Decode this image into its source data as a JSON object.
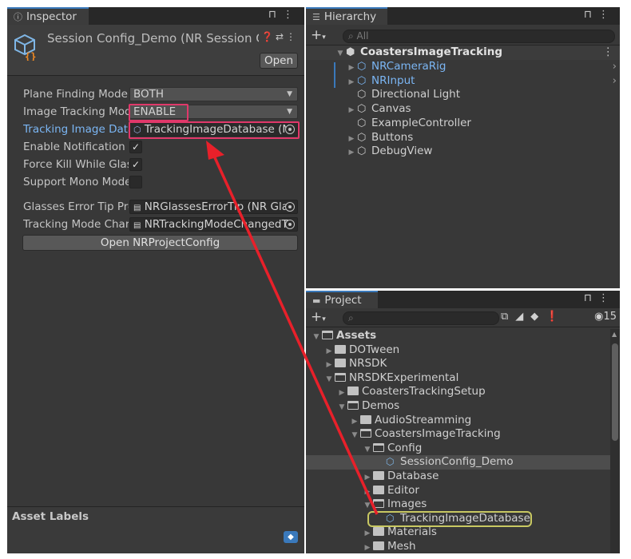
{
  "inspector": {
    "tab_label": "Inspector",
    "title": "Session Config_Demo (NR Session Co",
    "open_button": "Open",
    "fields": [
      {
        "label": "Plane Finding Mode",
        "value": "BOTH",
        "kind": "dropdown"
      },
      {
        "label": "Image Tracking Mod",
        "value": "ENABLE",
        "kind": "dropdown"
      },
      {
        "label": "Tracking Image Data",
        "value": "TrackingImageDatabase (N",
        "kind": "object"
      },
      {
        "label": "Enable Notification",
        "value": "✓",
        "kind": "checkbox"
      },
      {
        "label": "Force Kill While Glas",
        "value": "✓",
        "kind": "checkbox"
      },
      {
        "label": "Support Mono Mode",
        "value": "",
        "kind": "checkbox"
      },
      {
        "label": "Glasses Error Tip Pre",
        "value": "NRGlassesErrorTip (NR Glas",
        "kind": "object"
      },
      {
        "label": "Tracking Mode Char",
        "value": "NRTrackingModeChangedT",
        "kind": "object"
      }
    ],
    "project_config_button": "Open NRProjectConfig",
    "asset_labels": "Asset Labels"
  },
  "hierarchy": {
    "tab_label": "Hierarchy",
    "search_placeholder": "All",
    "scene": "CoastersImageTracking",
    "items": [
      "NRCameraRig",
      "NRInput",
      "Directional Light",
      "Canvas",
      "ExampleController",
      "Buttons",
      "DebugView"
    ]
  },
  "project": {
    "tab_label": "Project",
    "hidden_count": "15",
    "tree": [
      "Assets",
      "DOTween",
      "NRSDK",
      "NRSDKExperimental",
      "CoastersTrackingSetup",
      "Demos",
      "AudioStreamming",
      "CoastersImageTracking",
      "Config",
      "SessionConfig_Demo",
      "Database",
      "Editor",
      "Images",
      "TrackingImageDatabase",
      "Materials",
      "Mesh"
    ]
  },
  "colors": {
    "panel": "#383838",
    "accent_blue": "#3a79bb",
    "prefab_blue": "#7bb6f4",
    "highlight_red": "#e0386a",
    "highlight_yellow": "#c8c862",
    "arrow_red": "#e8202a"
  }
}
